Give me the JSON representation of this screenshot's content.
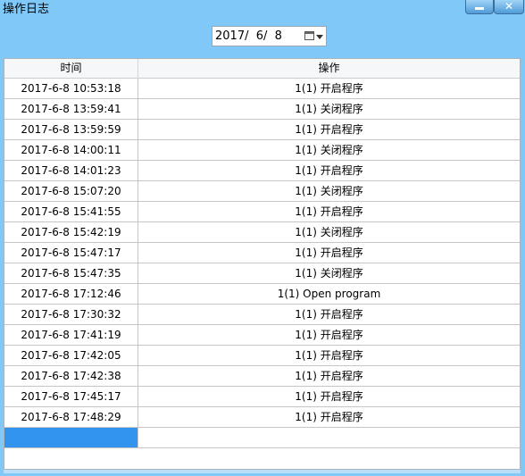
{
  "window": {
    "title": "操作日志",
    "minimize_glyph": "—",
    "close_glyph": "✕"
  },
  "datepicker": {
    "value": "2017/  6/  8",
    "icon": "calendar-icon"
  },
  "table": {
    "headers": {
      "time": "时间",
      "operation": "操作"
    },
    "rows": [
      {
        "time": "2017-6-8 10:53:18",
        "operation": "1(1) 开启程序"
      },
      {
        "time": "2017-6-8 13:59:41",
        "operation": "1(1) 关闭程序"
      },
      {
        "time": "2017-6-8 13:59:59",
        "operation": "1(1) 开启程序"
      },
      {
        "time": "2017-6-8 14:00:11",
        "operation": "1(1) 关闭程序"
      },
      {
        "time": "2017-6-8 14:01:23",
        "operation": "1(1) 开启程序"
      },
      {
        "time": "2017-6-8 15:07:20",
        "operation": "1(1) 关闭程序"
      },
      {
        "time": "2017-6-8 15:41:55",
        "operation": "1(1) 开启程序"
      },
      {
        "time": "2017-6-8 15:42:19",
        "operation": "1(1) 关闭程序"
      },
      {
        "time": "2017-6-8 15:47:17",
        "operation": "1(1) 开启程序"
      },
      {
        "time": "2017-6-8 15:47:35",
        "operation": "1(1) 关闭程序"
      },
      {
        "time": "2017-6-8 17:12:46",
        "operation": "1(1) Open program"
      },
      {
        "time": "2017-6-8 17:30:32",
        "operation": "1(1) 开启程序"
      },
      {
        "time": "2017-6-8 17:41:19",
        "operation": "1(1) 开启程序"
      },
      {
        "time": "2017-6-8 17:42:05",
        "operation": "1(1) 开启程序"
      },
      {
        "time": "2017-6-8 17:42:38",
        "operation": "1(1) 开启程序"
      },
      {
        "time": "2017-6-8 17:45:17",
        "operation": "1(1) 开启程序"
      },
      {
        "time": "2017-6-8 17:48:29",
        "operation": "1(1) 开启程序"
      }
    ]
  },
  "colors": {
    "window_bg": "#7fc8f8",
    "selection": "#3394f0"
  }
}
